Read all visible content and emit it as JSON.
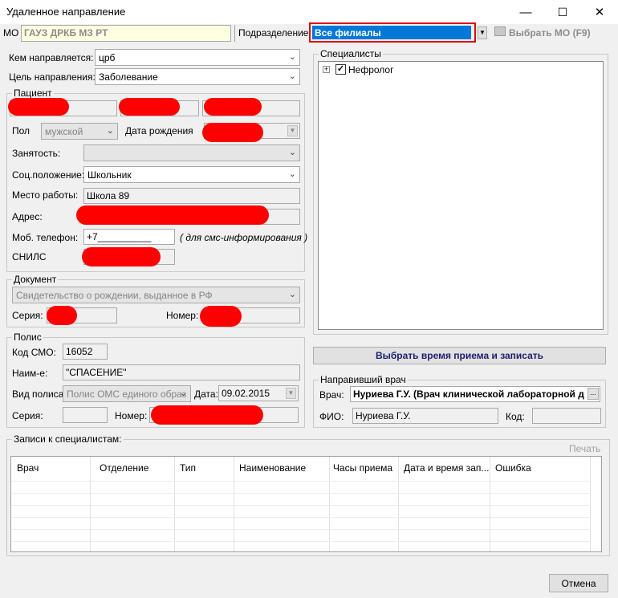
{
  "window": {
    "title": "Удаленное направление"
  },
  "top": {
    "mo_label": "МО",
    "mo_value": "ГАУЗ ДРКБ МЗ РТ",
    "subdivision_label": "Подразделение",
    "subdivision_value": "Все филиалы",
    "select_mo_button": "Выбрать МО (F9)"
  },
  "referral": {
    "sent_by_label": "Кем направляется:",
    "sent_by_value": "црб",
    "purpose_label": "Цель направления:",
    "purpose_value": "Заболевание"
  },
  "patient": {
    "group_title": "Пациент",
    "sex_label": "Пол",
    "sex_value": "мужской",
    "birth_label": "Дата рождения",
    "employment_label": "Занятость:",
    "social_label": "Соц.положение:",
    "social_value": "Школьник",
    "work_label": "Место работы:",
    "work_value": "Школа 89",
    "address_label": "Адрес:",
    "phone_label": "Моб. телефон:",
    "phone_value": "+7__________",
    "phone_hint": "( для смс-информирования )",
    "snils_label": "СНИЛС"
  },
  "document": {
    "group_title": "Документ",
    "type_value": "Свидетельство о рождении, выданное в РФ",
    "series_label": "Серия:",
    "number_label": "Номер:"
  },
  "policy": {
    "group_title": "Полис",
    "smo_code_label": "Код СМО:",
    "smo_code_value": "16052",
    "name_label": "Наим-е:",
    "name_value": "\"СПАСЕНИЕ\"",
    "type_label": "Вид полиса:",
    "type_value": "Полис ОМС единого образ",
    "date_label": "Дата:",
    "date_value": "09.02.2015",
    "series_label": "Серия:",
    "number_label": "Номер:"
  },
  "specialists": {
    "group_title": "Специалисты",
    "items": [
      {
        "label": "Нефролог",
        "checked": true
      }
    ],
    "tree_expand": "+",
    "check_glyph": "✓"
  },
  "schedule_button": "Выбрать время приема и записать",
  "referring_doctor": {
    "group_title": "Направивший врач",
    "doctor_label": "Врач:",
    "doctor_value": "Нуриева Г.У. (Врач клинической лабораторной д",
    "fio_label": "ФИО:",
    "fio_value": "Нуриева Г.У.",
    "code_label": "Код:"
  },
  "records": {
    "group_title": "Записи к специалистам:",
    "print_button": "Печать",
    "columns": [
      "Врач",
      "Отделение",
      "Тип",
      "Наименование",
      "Часы приема",
      "Дата и время зап...",
      "Ошибка"
    ]
  },
  "cancel_button": "Отмена",
  "icons": {
    "minimize": "—",
    "maximize": "☐",
    "close": "✕",
    "dropdown": "▼",
    "ellipsis": "..."
  }
}
